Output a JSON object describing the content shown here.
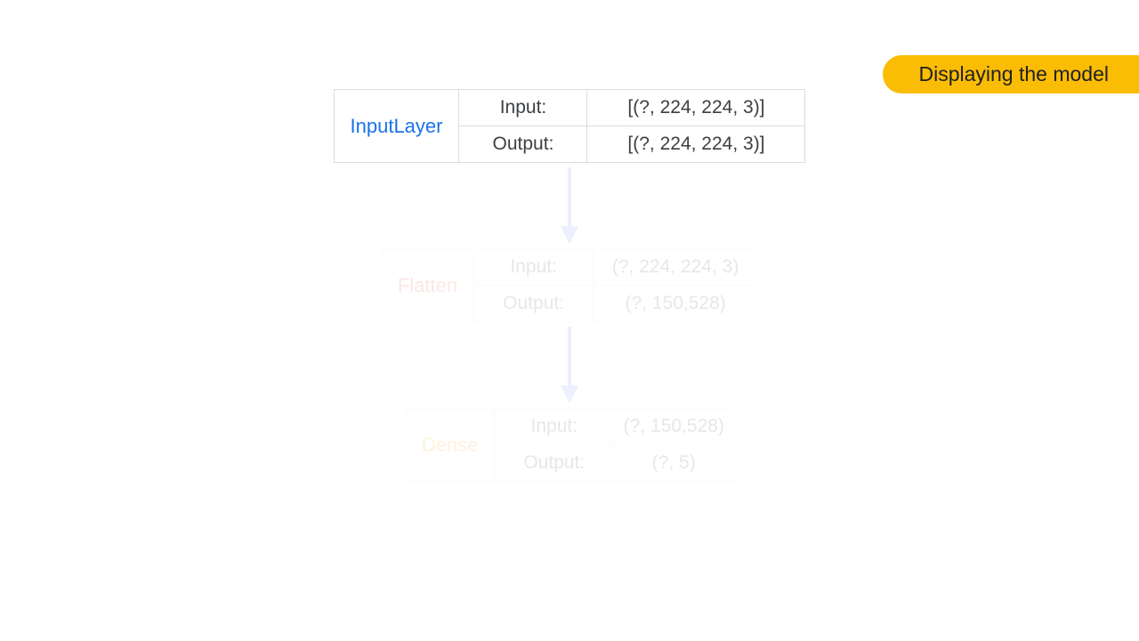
{
  "banner": {
    "title": "Displaying the model"
  },
  "colors": {
    "banner_bg": "#fbbc04",
    "arrow": "#c7d6ff",
    "name0": "#1a73e8",
    "name1": "#ea4335",
    "name2": "#f29900"
  },
  "labels": {
    "input": "Input:",
    "output": "Output:"
  },
  "nodes": [
    {
      "name": "InputLayer",
      "input": "[(?, 224, 224, 3)]",
      "output": "[(?, 224, 224, 3)]",
      "faded": false
    },
    {
      "name": "Flatten",
      "input": "(?, 224, 224, 3)",
      "output": "(?, 150,528)",
      "faded": true
    },
    {
      "name": "Dense",
      "input": "(?, 150,528)",
      "output": "(?, 5)",
      "faded": true
    }
  ]
}
